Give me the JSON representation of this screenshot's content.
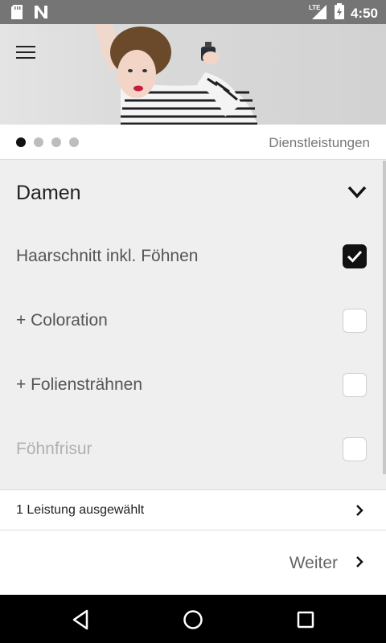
{
  "status_bar": {
    "time": "4:50",
    "network": "LTE",
    "icons": [
      "sd-card-icon",
      "n-notification-icon",
      "lte-signal-icon",
      "battery-charging-icon"
    ]
  },
  "hero": {
    "menu_icon": "hamburger-menu-icon",
    "image": "woman-with-perfume-photo"
  },
  "pager": {
    "pages": 4,
    "active_index": 0,
    "label": "Dienstleistungen"
  },
  "category": {
    "title": "Damen",
    "icon": "chevron-down-icon",
    "items": [
      {
        "label": "Haarschnitt inkl. Föhnen",
        "checked": true
      },
      {
        "label": "+ Coloration",
        "checked": false
      },
      {
        "label": "+ Foliensträhnen",
        "checked": false
      },
      {
        "label": "Föhnfrisur",
        "checked": false
      }
    ]
  },
  "selection": {
    "label": "1 Leistung ausgewählt",
    "icon": "chevron-right-icon"
  },
  "next": {
    "label": "Weiter",
    "icon": "chevron-right-icon"
  },
  "nav_bar": {
    "back": "back-icon",
    "home": "home-icon",
    "recents": "recents-icon"
  },
  "colors": {
    "accent": "#111111",
    "status_bar": "#757575",
    "list_bg": "#efefef"
  }
}
